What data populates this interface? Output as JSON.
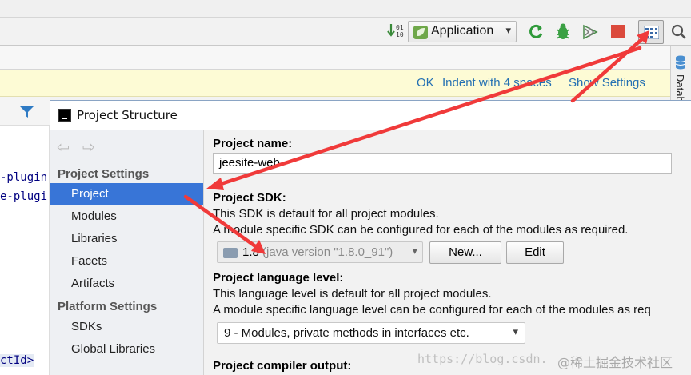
{
  "toolbar": {
    "run_config": "Application",
    "caret": "▾"
  },
  "notification": {
    "ok": "OK",
    "indent": "Indent with 4 spaces",
    "show_settings": "Show Settings"
  },
  "right_strip": {
    "label": "Datab"
  },
  "editor": {
    "lines": [
      "-plugin",
      "e-plugi",
      "ctId>"
    ]
  },
  "dialog": {
    "title": "Project Structure",
    "back": "⇦",
    "forward": "⇨",
    "sidebar": {
      "project_settings_heading": "Project Settings",
      "project_settings_items": [
        "Project",
        "Modules",
        "Libraries",
        "Facets",
        "Artifacts"
      ],
      "platform_settings_heading": "Platform Settings",
      "platform_settings_items": [
        "SDKs",
        "Global Libraries"
      ]
    },
    "content": {
      "name_label": "Project name:",
      "name_value": "jeesite-web",
      "sdk_label": "Project SDK:",
      "sdk_desc_1": "This SDK is default for all project modules.",
      "sdk_desc_2": "A module specific SDK can be configured for each of the modules as required.",
      "sdk_version": "1.8",
      "sdk_detail": " (java version \"1.8.0_91\")",
      "new_button": "New...",
      "edit_button": "Edit",
      "lang_label": "Project language level:",
      "lang_desc_1": "This language level is default for all project modules.",
      "lang_desc_2": "A module specific language level can be configured for each of the modules as req",
      "lang_value": "9 - Modules, private methods in interfaces etc.",
      "output_label": "Project compiler output:"
    }
  },
  "watermark": {
    "url": "https://blog.csdn.",
    "site": "@稀土掘金技术社区"
  },
  "colors": {
    "selection": "#3875d7",
    "link": "#2470b3",
    "arrow": "#f03a3a",
    "notification_bg": "#fdfbd5"
  }
}
